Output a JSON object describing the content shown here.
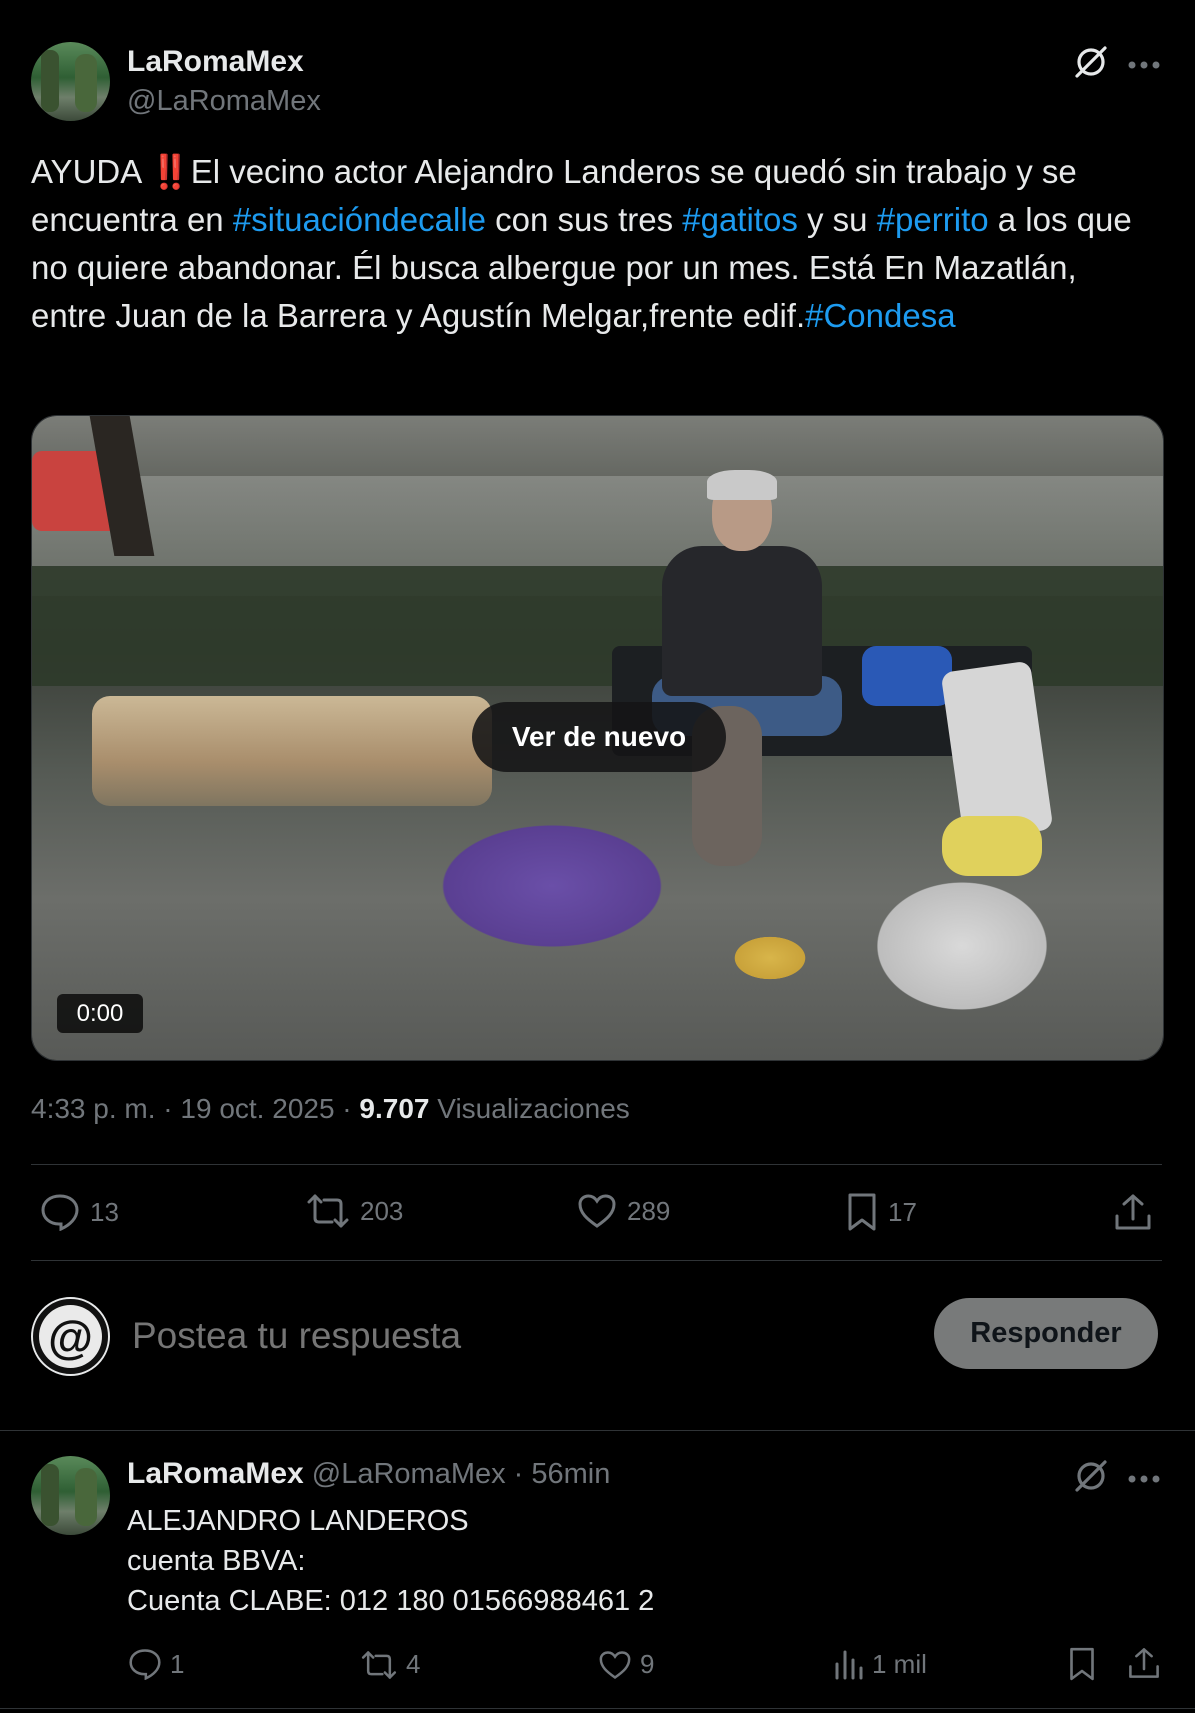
{
  "post": {
    "author_name": "LaRomaMex",
    "author_handle": "@LaRomaMex",
    "text_parts": {
      "p1": "AYUDA ",
      "emoji": "‼️",
      "p2": "El vecino actor Alejandro Landeros se quedó sin trabajo y se encuentra en ",
      "tag1": "#situacióndecalle",
      "p3": " con sus tres ",
      "tag2": "#gatitos",
      "p4": " y su ",
      "tag3": "#perrito",
      "p5": " a los que no quiere abandonar. Él busca albergue por un mes. Está En Mazatlán, entre Juan de la Barrera y Agustín Melgar,frente edif.",
      "tag4": "#Condesa"
    },
    "video": {
      "replay_label": "Ver de nuevo",
      "duration": "0:00"
    },
    "meta": {
      "time": "4:33 p. m.",
      "sep1": " · ",
      "date": "19 oct. 2025",
      "sep2": " · ",
      "views_count": "9.707",
      "views_label": " Visualizaciones"
    },
    "actions": {
      "replies": "13",
      "reposts": "203",
      "likes": "289",
      "bookmarks": "17"
    }
  },
  "composer": {
    "placeholder": "Postea tu respuesta",
    "avatar_glyph": "@",
    "submit_label": "Responder"
  },
  "reply": {
    "author_name": "LaRomaMex",
    "author_handle": "@LaRomaMex",
    "time": " · 56min",
    "lines": [
      "ALEJANDRO LANDEROS",
      "cuenta BBVA:",
      "Cuenta CLABE: 012 180 01566988461 2"
    ],
    "actions": {
      "replies": "1",
      "reposts": "4",
      "likes": "9",
      "views": "1 mil"
    }
  },
  "colors": {
    "background": "#000000",
    "text": "#e7e9ea",
    "muted": "#71767b",
    "link": "#1d9bf0",
    "divider": "#2f3336"
  }
}
